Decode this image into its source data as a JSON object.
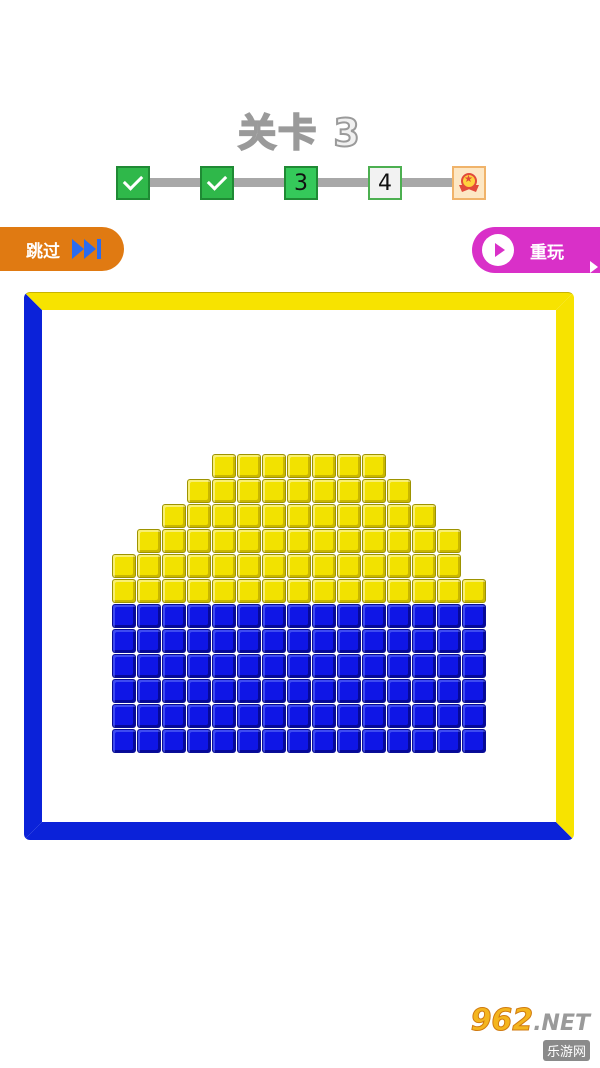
{
  "header": {
    "title": "关卡 3"
  },
  "progress": {
    "steps": [
      {
        "state": "done",
        "label": ""
      },
      {
        "state": "done",
        "label": ""
      },
      {
        "state": "current",
        "label": "3"
      },
      {
        "state": "next",
        "label": "4"
      },
      {
        "state": "reward",
        "label": ""
      }
    ]
  },
  "controls": {
    "skip_label": "跳过",
    "replay_label": "重玩"
  },
  "board": {
    "frame_colors": {
      "left": "#0b22d9",
      "bottom": "#0b22d9",
      "top": "#f7e300",
      "right": "#f7e300"
    },
    "palette": {
      "Y": "yellow",
      "B": "blue"
    },
    "rows": [
      "...YYYYYYY...",
      "..YYYYYYYYY..",
      ".YYYYYYYYYYY.",
      "YYYYYYYYYYYYY",
      "YYYYYYYYYYYYYY",
      "YYYYYYYYYYYYYYY",
      "BBBBBBBBBBBBBBB",
      "BBBBBBBBBBBBBBB",
      "BBBBBBBBBBBBBBB",
      "BBBBBBBBBBBBBBB",
      "BBBBBBBBBBBBBBB",
      "BBBBBBBBBBBBBBB"
    ]
  },
  "watermark": {
    "top": "962",
    "top_suffix": ".NET",
    "bottom": "乐游网"
  }
}
